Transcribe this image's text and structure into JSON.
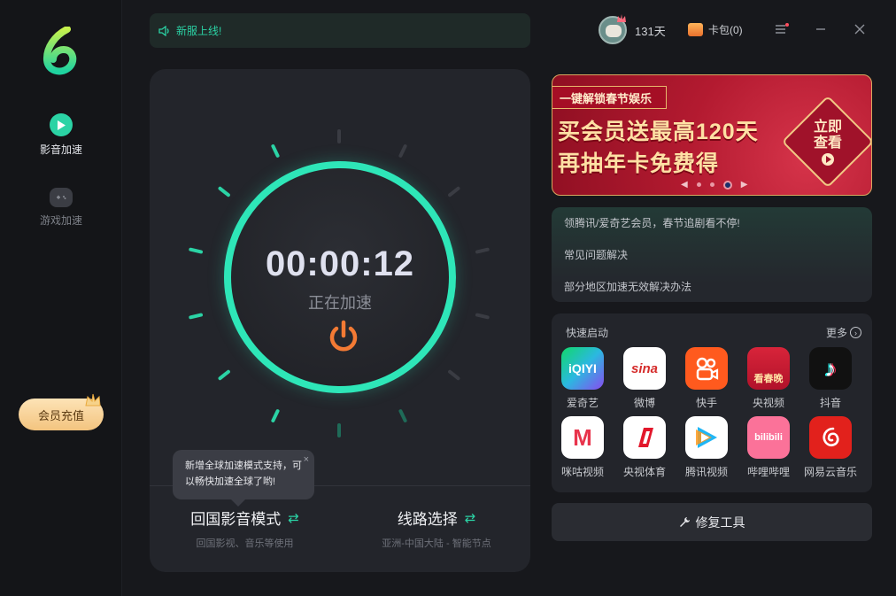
{
  "sidebar": {
    "items": [
      {
        "label": "影音加速",
        "icon": "play-icon",
        "active": true
      },
      {
        "label": "游戏加速",
        "icon": "gamepad-icon",
        "active": false
      }
    ],
    "vip_label": "会员充值"
  },
  "notice": {
    "text": "新服上线!",
    "icon": "speaker-icon"
  },
  "header": {
    "days": "131天",
    "wallet": "卡包(0)"
  },
  "accelerator": {
    "timer": "00:00:12",
    "status": "正在加速",
    "tooltip": "新增全球加速模式支持，可以畅快加速全球了哟!",
    "tooltip_close": "×",
    "mode": {
      "title": "回国影音模式",
      "subtitle": "回国影视、音乐等使用"
    },
    "route": {
      "title": "线路选择",
      "subtitle": "亚洲-中国大陆 - 智能节点"
    },
    "colors": {
      "ring": "#2ee6b8",
      "power": "#f37a34",
      "accent": "#2bd3a5"
    }
  },
  "banner": {
    "tag": "一键解锁春节娱乐",
    "line1": "买会员送最高120天",
    "line2": "再抽年卡免费得",
    "cta_line1": "立即",
    "cta_line2": "查看",
    "prev": "◀",
    "next": "▶",
    "dots": 3,
    "active_dot": 2
  },
  "links": [
    "领腾讯/爱奇艺会员，春节追剧看不停!",
    "常见问题解决",
    "部分地区加速无效解决办法"
  ],
  "quick_start": {
    "title": "快速启动",
    "more": "更多",
    "apps": [
      {
        "name": "爱奇艺",
        "logo": "iQIYI"
      },
      {
        "name": "微博",
        "logo": "sina"
      },
      {
        "name": "快手",
        "logo": ""
      },
      {
        "name": "央视频",
        "logo": "看春晚"
      },
      {
        "name": "抖音",
        "logo": "♪"
      },
      {
        "name": "咪咕视频",
        "logo": "M"
      },
      {
        "name": "央视体育",
        "logo": ""
      },
      {
        "name": "腾讯视频",
        "logo": ""
      },
      {
        "name": "哔哩哔哩",
        "logo": "bilibili"
      },
      {
        "name": "网易云音乐",
        "logo": ""
      }
    ]
  },
  "repair": {
    "label": "修复工具"
  }
}
